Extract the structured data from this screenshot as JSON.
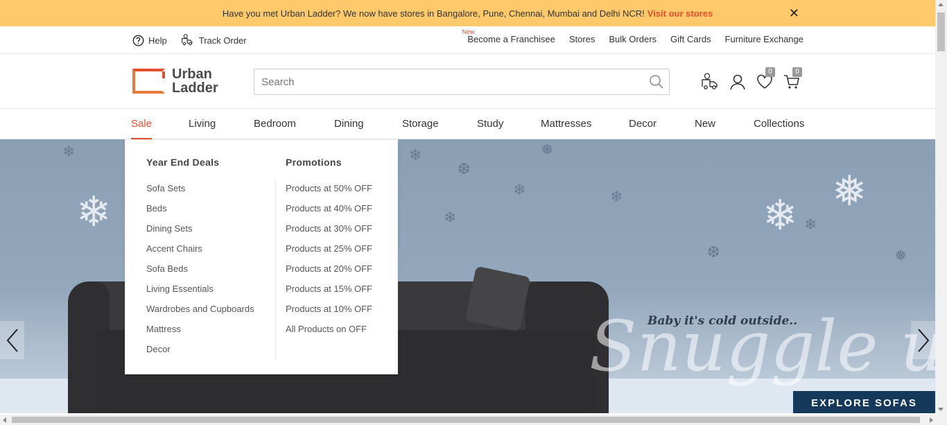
{
  "announcement": {
    "text": "Have you met Urban Ladder? We now have stores in Bangalore, Pune, Chennai, Mumbai and Delhi NCR!",
    "link": "Visit our stores",
    "close": "✕"
  },
  "utility": {
    "help": "Help",
    "track_order": "Track Order",
    "new_tag": "New",
    "links": [
      "Become a Franchisee",
      "Stores",
      "Bulk Orders",
      "Gift Cards",
      "Furniture Exchange"
    ]
  },
  "header": {
    "logo_line1": "Urban",
    "logo_line2": "Ladder",
    "search_placeholder": "Search",
    "wishlist_count": "0",
    "cart_count": "0"
  },
  "nav": {
    "items": [
      "Sale",
      "Living",
      "Bedroom",
      "Dining",
      "Storage",
      "Study",
      "Mattresses",
      "Decor",
      "New",
      "Collections"
    ],
    "active": "Sale"
  },
  "dropdown": {
    "col1": {
      "heading": "Year End Deals",
      "items": [
        "Sofa Sets",
        "Beds",
        "Dining Sets",
        "Accent Chairs",
        "Sofa Beds",
        "Living Essentials",
        "Wardrobes and Cupboards",
        "Mattress",
        "Decor"
      ]
    },
    "col2": {
      "heading": "Promotions",
      "items": [
        "Products at 50% OFF",
        "Products at 40% OFF",
        "Products at 30% OFF",
        "Products at 25% OFF",
        "Products at 20% OFF",
        "Products at 15% OFF",
        "Products at 10% OFF",
        "All Products on OFF"
      ]
    }
  },
  "hero": {
    "tagline": "Baby it's cold outside..",
    "script": "Snuggle up",
    "cta": "EXPLORE SOFAS"
  },
  "colors": {
    "accent": "#e34e2b",
    "banner": "#fdc96b",
    "cta": "#14395a"
  }
}
